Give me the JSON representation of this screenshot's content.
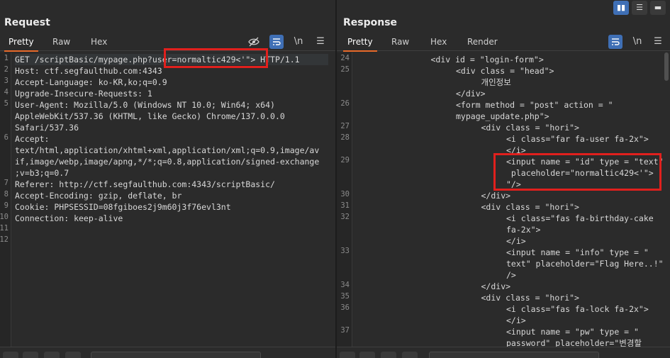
{
  "request": {
    "title": "Request",
    "tabs": [
      "Pretty",
      "Raw",
      "Hex"
    ],
    "active_tab": "Pretty",
    "toolbar": {
      "hide_icon": "eye-slash-icon",
      "wrap_icon": "wrap-icon",
      "newline_label": "\\n",
      "menu_icon": "hamburger-icon"
    },
    "lines": [
      {
        "n": "1",
        "text": "GET /scriptBasic/mypage.php?user=normaltic429<'\"> HTTP/1.1"
      },
      {
        "n": "2",
        "text": "Host: ctf.segfaulthub.com:4343"
      },
      {
        "n": "3",
        "text": "Accept-Language: ko-KR,ko;q=0.9"
      },
      {
        "n": "4",
        "text": "Upgrade-Insecure-Requests: 1"
      },
      {
        "n": "5",
        "text": "User-Agent: Mozilla/5.0 (Windows NT 10.0; Win64; x64)"
      },
      {
        "n": "",
        "text": "AppleWebKit/537.36 (KHTML, like Gecko) Chrome/137.0.0.0"
      },
      {
        "n": "",
        "text": "Safari/537.36"
      },
      {
        "n": "6",
        "text": "Accept:"
      },
      {
        "n": "",
        "text": "text/html,application/xhtml+xml,application/xml;q=0.9,image/av"
      },
      {
        "n": "",
        "text": "if,image/webp,image/apng,*/*;q=0.8,application/signed-exchange"
      },
      {
        "n": "",
        "text": ";v=b3;q=0.7"
      },
      {
        "n": "7",
        "text": "Referer: http://ctf.segfaulthub.com:4343/scriptBasic/"
      },
      {
        "n": "8",
        "text": "Accept-Encoding: gzip, deflate, br"
      },
      {
        "n": "9",
        "text": "Cookie: PHPSESSID=08fgiboes2j9m60j3f76evl3nt"
      },
      {
        "n": "10",
        "text": "Connection: keep-alive"
      },
      {
        "n": "11",
        "text": ""
      },
      {
        "n": "12",
        "text": ""
      }
    ]
  },
  "response": {
    "title": "Response",
    "tabs": [
      "Pretty",
      "Raw",
      "Hex",
      "Render"
    ],
    "active_tab": "Pretty",
    "toolbar": {
      "wrap_icon": "wrap-icon",
      "newline_label": "\\n",
      "menu_icon": "hamburger-icon"
    },
    "lines": [
      {
        "n": "24",
        "indent": 3,
        "text": "<div id = \"login-form\">"
      },
      {
        "n": "25",
        "indent": 4,
        "text": "<div class = \"head\">"
      },
      {
        "n": "",
        "indent": 5,
        "text": "개인정보"
      },
      {
        "n": "",
        "indent": 4,
        "text": "</div>"
      },
      {
        "n": "26",
        "indent": 4,
        "text": "<form method = \"post\" action = \""
      },
      {
        "n": "",
        "indent": 4,
        "text": "mypage_update.php\">"
      },
      {
        "n": "27",
        "indent": 5,
        "text": "<div class = \"hori\">"
      },
      {
        "n": "28",
        "indent": 6,
        "text": "<i class=\"far fa-user fa-2x\">"
      },
      {
        "n": "",
        "indent": 6,
        "text": "</i>"
      },
      {
        "n": "29",
        "indent": 6,
        "text": "<input name = \"id\" type = \"text\""
      },
      {
        "n": "",
        "indent": 6,
        "text": " placeholder=\"normaltic429<'\">"
      },
      {
        "n": "",
        "indent": 6,
        "text": "\"/>"
      },
      {
        "n": "30",
        "indent": 5,
        "text": "</div>"
      },
      {
        "n": "31",
        "indent": 5,
        "text": "<div class = \"hori\">"
      },
      {
        "n": "32",
        "indent": 6,
        "text": "<i class=\"fas fa-birthday-cake"
      },
      {
        "n": "",
        "indent": 6,
        "text": "fa-2x\">"
      },
      {
        "n": "",
        "indent": 6,
        "text": "</i>"
      },
      {
        "n": "33",
        "indent": 6,
        "text": "<input name = \"info\" type = \""
      },
      {
        "n": "",
        "indent": 6,
        "text": "text\" placeholder=\"Flag Here..!\""
      },
      {
        "n": "",
        "indent": 6,
        "text": "/>"
      },
      {
        "n": "34",
        "indent": 5,
        "text": "</div>"
      },
      {
        "n": "35",
        "indent": 5,
        "text": "<div class = \"hori\">"
      },
      {
        "n": "36",
        "indent": 6,
        "text": "<i class=\"fas fa-lock fa-2x\">"
      },
      {
        "n": "",
        "indent": 6,
        "text": "</i>"
      },
      {
        "n": "37",
        "indent": 6,
        "text": "<input name = \"pw\" type = \""
      },
      {
        "n": "",
        "indent": 6,
        "text": "password\" placeholder=\"변경할"
      }
    ]
  },
  "layout_buttons": [
    "split-columns-icon",
    "split-rows-icon",
    "single-pane-icon"
  ],
  "colors": {
    "accent": "#e8692a",
    "highlight_box": "#e0201d",
    "button_blue": "#3f6fb5",
    "cookie_green": "#9ccc65"
  }
}
